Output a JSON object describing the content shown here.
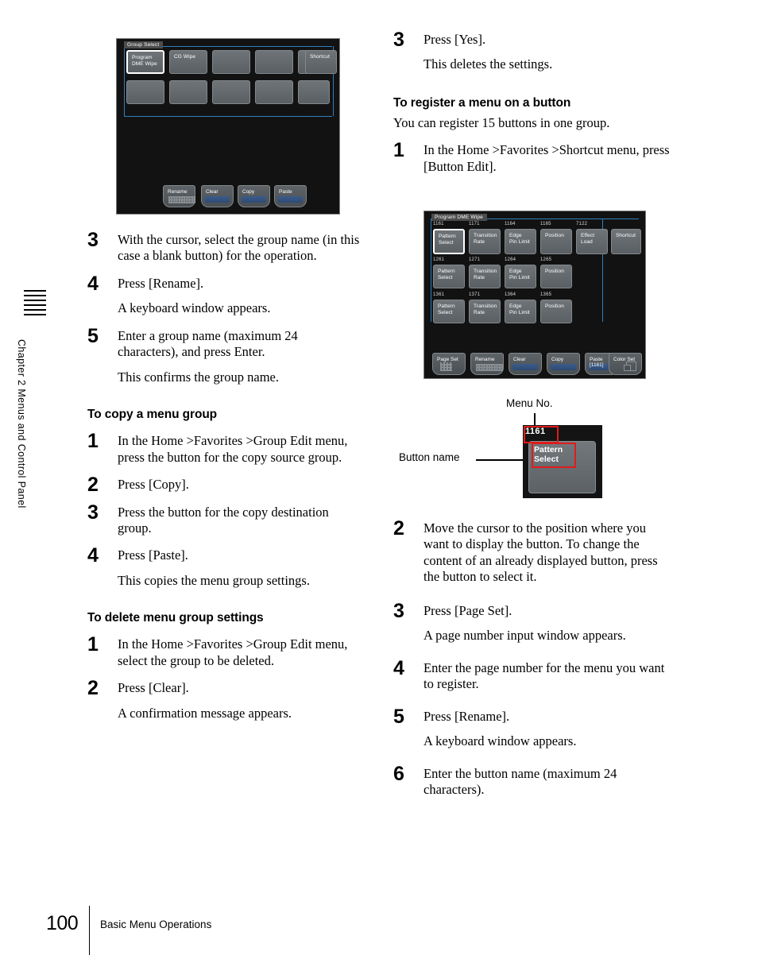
{
  "sidebar": {
    "chapter_text": "Chapter 2  Menus and Control Panel"
  },
  "footer": {
    "page_number": "100",
    "running_head": "Basic Menu Operations"
  },
  "figure_group_select": {
    "title": "Group Select",
    "row1": [
      {
        "line1": "Program",
        "line2": "DME Wipe",
        "selected": true
      },
      {
        "line1": "CG Wipe",
        "line2": "",
        "selected": false
      },
      {
        "line1": "",
        "line2": "",
        "selected": false
      },
      {
        "line1": "",
        "line2": "",
        "selected": false
      },
      {
        "line1": "",
        "line2": "",
        "selected": false
      }
    ],
    "row2": [
      {
        "line1": "",
        "line2": ""
      },
      {
        "line1": "",
        "line2": ""
      },
      {
        "line1": "",
        "line2": ""
      },
      {
        "line1": "",
        "line2": ""
      },
      {
        "line1": "",
        "line2": ""
      }
    ],
    "shortcut": "Shortcut",
    "bottom": [
      {
        "label": "Rename",
        "style": "grey"
      },
      {
        "label": "Clear",
        "style": "blue"
      },
      {
        "label": "Copy",
        "style": "blue"
      },
      {
        "label": "Paste",
        "style": "blue"
      }
    ]
  },
  "figure_button_edit": {
    "title": "Program DME Wipe",
    "shortcut": "Shortcut",
    "rows": [
      [
        {
          "no": "1161",
          "line1": "Pattern",
          "line2": "Select",
          "selected": true
        },
        {
          "no": "1171",
          "line1": "Transition",
          "line2": "Rate",
          "selected": false
        },
        {
          "no": "1164",
          "line1": "Edge",
          "line2": "Pin Limit",
          "selected": false
        },
        {
          "no": "1165",
          "line1": "Position",
          "line2": "",
          "selected": false
        },
        {
          "no": "7122",
          "line1": "Effect",
          "line2": "Load",
          "selected": false
        }
      ],
      [
        {
          "no": "1261",
          "line1": "Pattern",
          "line2": "Select",
          "selected": false
        },
        {
          "no": "1271",
          "line1": "Transition",
          "line2": "Rate",
          "selected": false
        },
        {
          "no": "1264",
          "line1": "Edge",
          "line2": "Pin Limit",
          "selected": false
        },
        {
          "no": "1265",
          "line1": "Position",
          "line2": "",
          "selected": false
        }
      ],
      [
        {
          "no": "1361",
          "line1": "Pattern",
          "line2": "Select",
          "selected": false
        },
        {
          "no": "1371",
          "line1": "Transition",
          "line2": "Rate",
          "selected": false
        },
        {
          "no": "1364",
          "line1": "Edge",
          "line2": "Pin Limit",
          "selected": false
        },
        {
          "no": "1365",
          "line1": "Position",
          "line2": "",
          "selected": false
        }
      ]
    ],
    "bottom": [
      {
        "label": "Page Set",
        "label2": "",
        "style": "grey"
      },
      {
        "label": "Rename",
        "label2": "",
        "style": "grey"
      },
      {
        "label": "Clear",
        "label2": "",
        "style": "blue"
      },
      {
        "label": "Copy",
        "label2": "",
        "style": "blue"
      },
      {
        "label": "Paste",
        "label2": "[1161]",
        "style": "blue"
      },
      {
        "label": "Color Set",
        "label2": "",
        "style": "grey"
      }
    ]
  },
  "callout": {
    "menu_no_label": "Menu No.",
    "button_name_label": "Button name",
    "menu_no_value": "1161",
    "button_name_line1": "Pattern",
    "button_name_line2": "Select",
    "highlight_color": "#e01b1b"
  },
  "left_column": {
    "step3": {
      "num": "3",
      "body": "With the cursor, select the group name (in this case a blank button) for the operation."
    },
    "step4": {
      "num": "4",
      "body": "Press [Rename]."
    },
    "step4_note": "A keyboard window appears.",
    "step5": {
      "num": "5",
      "body": "Enter a group name (maximum 24 characters), and press Enter."
    },
    "step5_note": "This confirms the group name.",
    "copy_heading": "To copy a menu group",
    "copy_step1": {
      "num": "1",
      "body": "In the Home >Favorites >Group Edit menu, press the button for the copy source group."
    },
    "copy_step2": {
      "num": "2",
      "body": "Press [Copy]."
    },
    "copy_step3": {
      "num": "3",
      "body": "Press the button for the copy destination group."
    },
    "copy_step4": {
      "num": "4",
      "body": "Press [Paste]."
    },
    "copy_step4_note": "This copies the menu group settings.",
    "delete_heading": "To delete menu group settings",
    "delete_step1": {
      "num": "1",
      "body": "In the Home >Favorites >Group Edit menu, select the group to be deleted."
    },
    "delete_step2": {
      "num": "2",
      "body": "Press [Clear]."
    },
    "delete_step2_note": "A confirmation message appears."
  },
  "right_column": {
    "step3": {
      "num": "3",
      "body": "Press [Yes]."
    },
    "step3_note": "This deletes the settings.",
    "register_heading": "To register a menu on a button",
    "register_lead": "You can register 15 buttons in one group.",
    "reg_step1": {
      "num": "1",
      "body": "In the Home >Favorites >Shortcut menu, press [Button Edit]."
    },
    "reg_step2": {
      "num": "2",
      "body": "Move the cursor to the position where you want to display the button. To change the content of an already displayed button, press the button to select it."
    },
    "reg_step3": {
      "num": "3",
      "body": "Press [Page Set]."
    },
    "reg_step3_note": "A page number input window appears.",
    "reg_step4": {
      "num": "4",
      "body": "Enter the page number for the menu you want to register."
    },
    "reg_step5": {
      "num": "5",
      "body": "Press [Rename]."
    },
    "reg_step5_note": "A keyboard window appears.",
    "reg_step6": {
      "num": "6",
      "body": "Enter the button name (maximum 24 characters)."
    }
  }
}
